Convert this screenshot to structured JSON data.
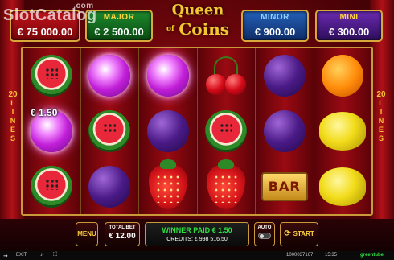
{
  "watermark": {
    "text": "SlotCatalog",
    "com": ".com"
  },
  "jackpots": {
    "grand": {
      "label": "",
      "value": "€ 75 000.00"
    },
    "major": {
      "label": "MAJOR",
      "value": "€ 2 500.00"
    },
    "minor": {
      "label": "MINOR",
      "value": "€ 900.00"
    },
    "mini": {
      "label": "MINI",
      "value": "€ 300.00"
    }
  },
  "logo": {
    "line1": "Queen",
    "of": "of",
    "coins": "Coins"
  },
  "lines": {
    "count": "20",
    "word": [
      "L",
      "I",
      "N",
      "E",
      "S"
    ]
  },
  "reels": [
    [
      "watermelon",
      "plum-glow",
      "watermelon"
    ],
    [
      "plum-glow",
      "watermelon",
      "plum"
    ],
    [
      "plum-glow",
      "plum",
      "strawberry"
    ],
    [
      "cherry",
      "watermelon",
      "strawberry"
    ],
    [
      "plum",
      "plum",
      "bar"
    ],
    [
      "orange",
      "lemon",
      "lemon"
    ]
  ],
  "win_label": "€ 1.50",
  "bar_symbol_text": "BAR",
  "panel": {
    "menu_label": "MENU",
    "total_bet_label": "TOTAL BET",
    "total_bet_value": "€ 12.00",
    "winner_paid": "WINNER PAID € 1.50",
    "credits": "CREDITS: € 998 516.50",
    "auto_label": "AUTO",
    "start_label": "START"
  },
  "statusbar": {
    "exit": "EXIT",
    "round_id": "1000037167",
    "time": "15:35",
    "brand": "greentube"
  }
}
